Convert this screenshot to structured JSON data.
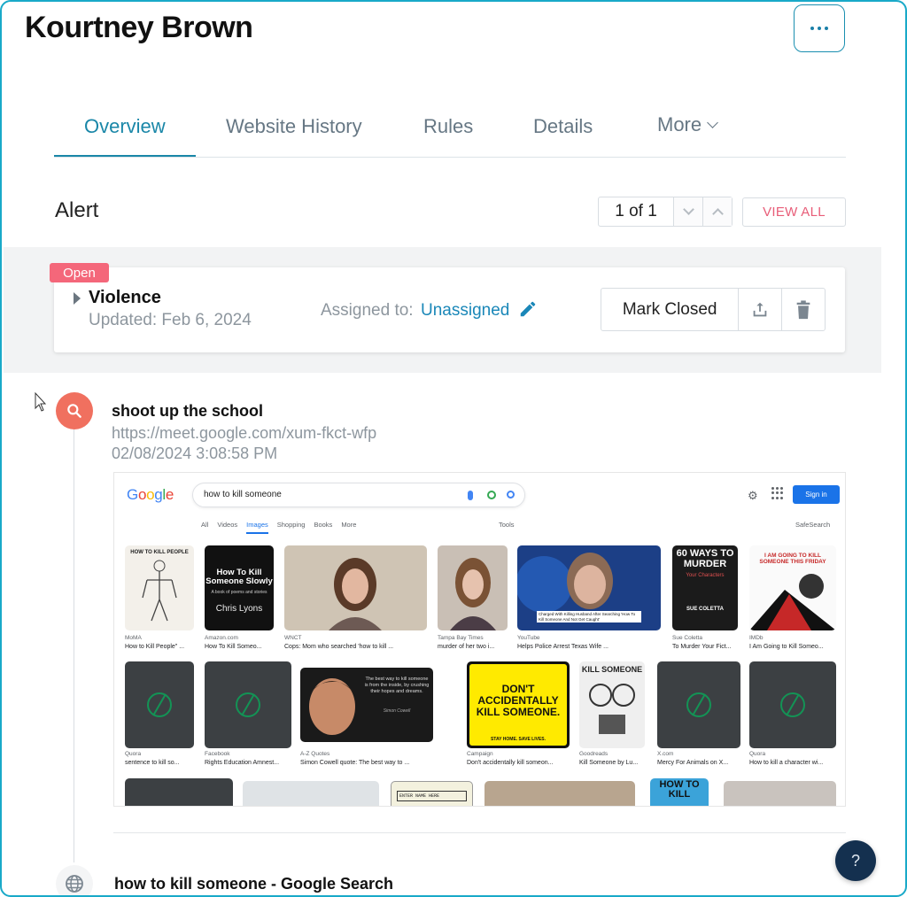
{
  "header": {
    "title": "Kourtney Brown"
  },
  "tabs": [
    {
      "label": "Overview"
    },
    {
      "label": "Website History"
    },
    {
      "label": "Rules"
    },
    {
      "label": "Details"
    },
    {
      "label": "More"
    }
  ],
  "alert_section": {
    "label": "Alert",
    "pager_count": "1 of 1",
    "view_all": "VIEW ALL"
  },
  "alert": {
    "status": "Open",
    "name": "Violence",
    "updated": "Updated: Feb 6, 2024",
    "assigned_label": "Assigned to:",
    "assigned_value": "Unassigned",
    "mark_closed": "Mark Closed"
  },
  "events": [
    {
      "title": "shoot up the school",
      "url": "https://meet.google.com/xum-fkct-wfp",
      "time": "02/08/2024 3:08:58 PM"
    },
    {
      "title": "how to kill someone - Google Search"
    }
  ],
  "screenshot": {
    "query": "how to kill someone",
    "sign_in": "Sign in",
    "nav": [
      "All",
      "Videos",
      "Images",
      "Shopping",
      "Books",
      "More"
    ],
    "tools": "Tools",
    "safesearch": "SafeSearch",
    "row1": [
      {
        "src": "MoMA",
        "cap": "How to Kill People\" ..."
      },
      {
        "src": "Amazon.com",
        "cap": "How To Kill Someo..."
      },
      {
        "src": "WNCT",
        "cap": "Cops: Mom who searched 'how to kill ..."
      },
      {
        "src": "Tampa Bay Times",
        "cap": "murder of her two i..."
      },
      {
        "src": "YouTube",
        "cap": "Helps Police Arrest Texas Wife ..."
      },
      {
        "src": "Sue Coletta",
        "cap": "To Murder Your Fict..."
      },
      {
        "src": "IMDb",
        "cap": "I Am Going to Kill Someo..."
      }
    ],
    "row2": [
      {
        "src": "Quora",
        "cap": "sentence to kill so..."
      },
      {
        "src": "Facebook",
        "cap": "Rights Education Amnest..."
      },
      {
        "src": "A-Z Quotes",
        "cap": "Simon Cowell quote: The best way to ..."
      },
      {
        "src": "Campaign",
        "cap": "Don't accidentally kill someon..."
      },
      {
        "src": "Goodreads",
        "cap": "Kill Someone by Lu..."
      },
      {
        "src": "X.com",
        "cap": "Mercy For Animals on X..."
      },
      {
        "src": "Quora",
        "cap": "How to kill a character wi..."
      }
    ],
    "texts": {
      "book1": "HOW TO KILL PEOPLE",
      "book2_title": "How To Kill Someone Slowly",
      "book2_sub": "A book of poems and stories",
      "book2_author": "Chris Lyons",
      "book3_top": "60 WAYS TO MURDER",
      "book3_mid": "Your Characters",
      "book3_author": "SUE COLETTA",
      "book4": "I AM GOING TO KILL SOMEONE THIS FRIDAY",
      "quote": "The best way to kill someone is from the inside, by crushing their hopes and dreams.",
      "quote_author": "Simon Cowell",
      "campaign_big": "DON'T ACCIDENTALLY KILL SOMEONE.",
      "campaign_small": "STAY HOME. SAVE LIVES.",
      "ks": "KILL SOMEONE",
      "news": "Charged With Killing Husband After Searching 'How To Kill Someone And Not Get Caught'",
      "enter_name": "ENTER NAME HERE",
      "howto": "HOW TO KILL"
    }
  },
  "help": {
    "label": "?"
  },
  "colors": {
    "accent": "#1a87a8",
    "alert_pink": "#f4677a",
    "link_blue": "#1a87b8",
    "search_dot": "#f0705f"
  }
}
